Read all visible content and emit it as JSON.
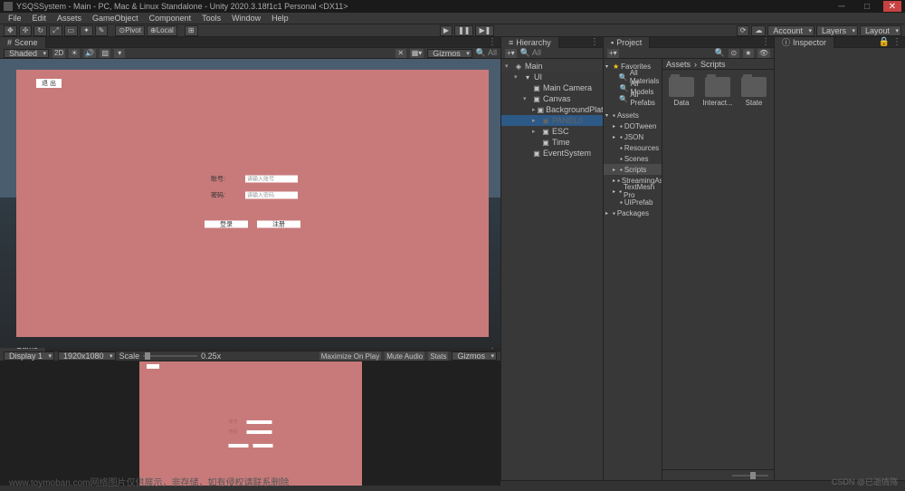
{
  "title": "YSQSSystem - Main - PC, Mac & Linux Standalone - Unity 2020.3.18f1c1 Personal <DX11>",
  "menu": [
    "File",
    "Edit",
    "Assets",
    "GameObject",
    "Component",
    "Tools",
    "Window",
    "Help"
  ],
  "toolbar": {
    "pivot": "Pivot",
    "local": "Local",
    "account": "Account",
    "layers": "Layers",
    "layout": "Layout"
  },
  "scene": {
    "tab": "Scene",
    "shading": "Shaded",
    "mode2d": "2D",
    "gizmos": "Gizmos",
    "form": {
      "exit": "退 出",
      "account_label": "账号:",
      "account_ph": "请输入账号",
      "password_label": "密码:",
      "password_ph": "请输入密码",
      "login": "登录",
      "register": "注册"
    }
  },
  "game": {
    "tab": "Game",
    "display": "Display 1",
    "resolution": "1920x1080",
    "scale_label": "Scale",
    "scale_value": "0.25x",
    "maximize": "Maximize On Play",
    "mute": "Mute Audio",
    "stats": "Stats",
    "gizmos": "Gizmos"
  },
  "hierarchy": {
    "tab": "Hierarchy",
    "items": [
      {
        "label": "Main",
        "icon": "◈",
        "depth": 0,
        "arrow": "▾",
        "root": true
      },
      {
        "label": "UI",
        "icon": "▾",
        "depth": 1,
        "arrow": "▾"
      },
      {
        "label": "Main Camera",
        "icon": "▣",
        "depth": 2,
        "arrow": ""
      },
      {
        "label": "Canvas",
        "icon": "▣",
        "depth": 2,
        "arrow": "▾"
      },
      {
        "label": "BackgroundPlate",
        "icon": "▣",
        "depth": 3,
        "arrow": "▸"
      },
      {
        "label": "PANEL0",
        "icon": "▣",
        "depth": 3,
        "arrow": "▸",
        "selected": true,
        "disabled": true
      },
      {
        "label": "ESC",
        "icon": "▣",
        "depth": 3,
        "arrow": "▸"
      },
      {
        "label": "Time",
        "icon": "▣",
        "depth": 3,
        "arrow": ""
      },
      {
        "label": "EventSystem",
        "icon": "▣",
        "depth": 2,
        "arrow": ""
      }
    ]
  },
  "project": {
    "tab": "Project",
    "breadcrumb": [
      "Assets",
      "Scripts"
    ],
    "favorites": {
      "label": "Favorites",
      "items": [
        "All Materials",
        "All Models",
        "All Prefabs"
      ]
    },
    "tree": [
      {
        "label": "Assets",
        "depth": 0,
        "arrow": "▾"
      },
      {
        "label": "DOTween",
        "depth": 1,
        "arrow": "▸"
      },
      {
        "label": "JSON",
        "depth": 1,
        "arrow": "▸"
      },
      {
        "label": "Resources",
        "depth": 1,
        "arrow": ""
      },
      {
        "label": "Scenes",
        "depth": 1,
        "arrow": ""
      },
      {
        "label": "Scripts",
        "depth": 1,
        "arrow": "▸",
        "sel": true
      },
      {
        "label": "StreamingAsse",
        "depth": 1,
        "arrow": "▸"
      },
      {
        "label": "TextMesh Pro",
        "depth": 1,
        "arrow": "▸"
      },
      {
        "label": "UIPrefab",
        "depth": 1,
        "arrow": ""
      },
      {
        "label": "Packages",
        "depth": 0,
        "arrow": "▸"
      }
    ],
    "folders": [
      "Data",
      "Interact...",
      "State"
    ]
  },
  "inspector": {
    "tab": "Inspector"
  },
  "watermark": "CSDN @已逝情殇",
  "watermark_bl": "www.toymoban.com网络图片仅供展示，非存储，如有侵权请联系删除"
}
